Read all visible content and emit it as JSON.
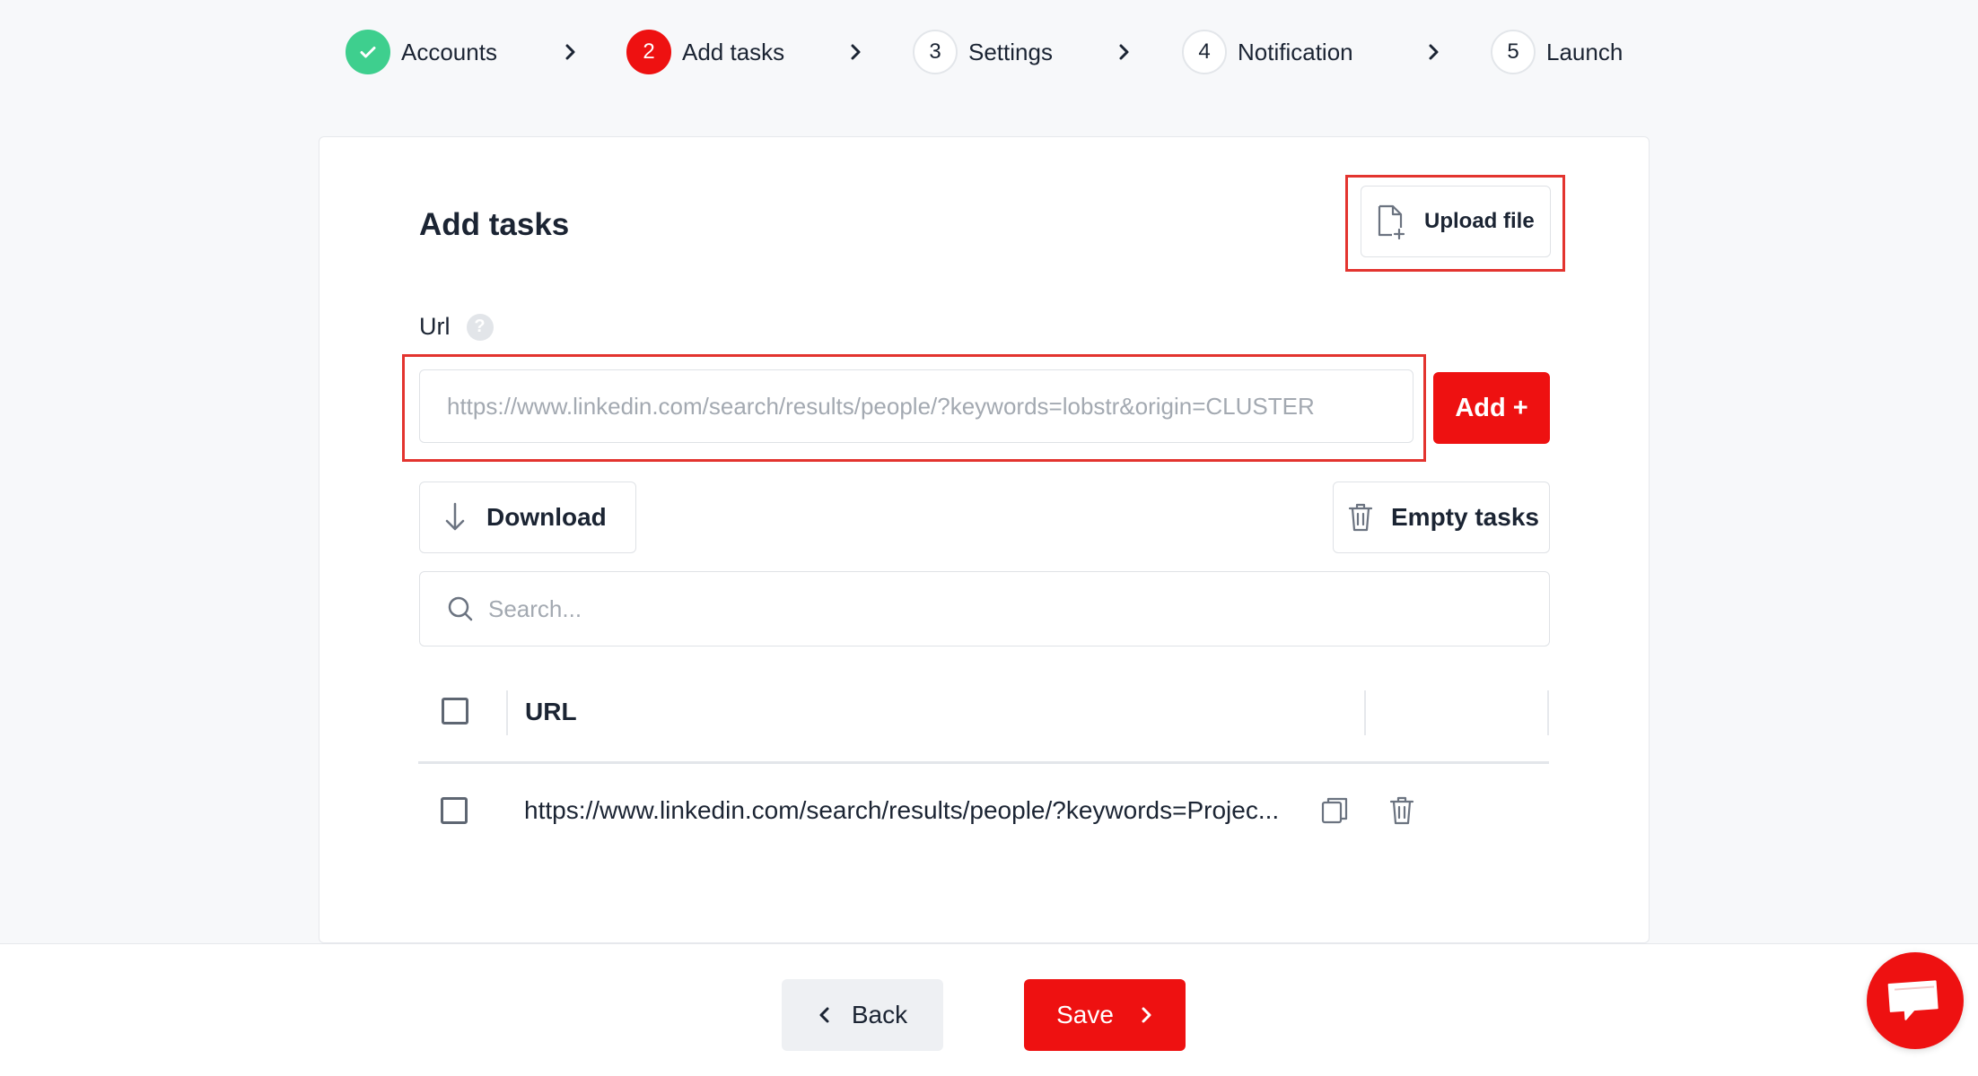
{
  "stepper": {
    "steps": [
      {
        "number": "",
        "label": "Accounts",
        "state": "done",
        "icon": "check-icon"
      },
      {
        "number": "2",
        "label": "Add tasks",
        "state": "active"
      },
      {
        "number": "3",
        "label": "Settings",
        "state": "pending"
      },
      {
        "number": "4",
        "label": "Notification",
        "state": "pending"
      },
      {
        "number": "5",
        "label": "Launch",
        "state": "pending"
      }
    ]
  },
  "card": {
    "title": "Add tasks",
    "upload_label": "Upload file",
    "url_label": "Url",
    "url_help": "?",
    "url_placeholder": "https://www.linkedin.com/search/results/people/?keywords=lobstr&origin=CLUSTER",
    "add_label": "Add +",
    "download_label": "Download",
    "empty_label": "Empty tasks",
    "search_placeholder": "Search..."
  },
  "table": {
    "columns": [
      "URL"
    ],
    "rows": [
      {
        "url": "https://www.linkedin.com/search/results/people/?keywords=Projec..."
      }
    ]
  },
  "footer": {
    "back_label": "Back",
    "save_label": "Save"
  },
  "colors": {
    "accent": "#ee1111",
    "success": "#3ecf8e",
    "highlight": "#e3342f"
  }
}
